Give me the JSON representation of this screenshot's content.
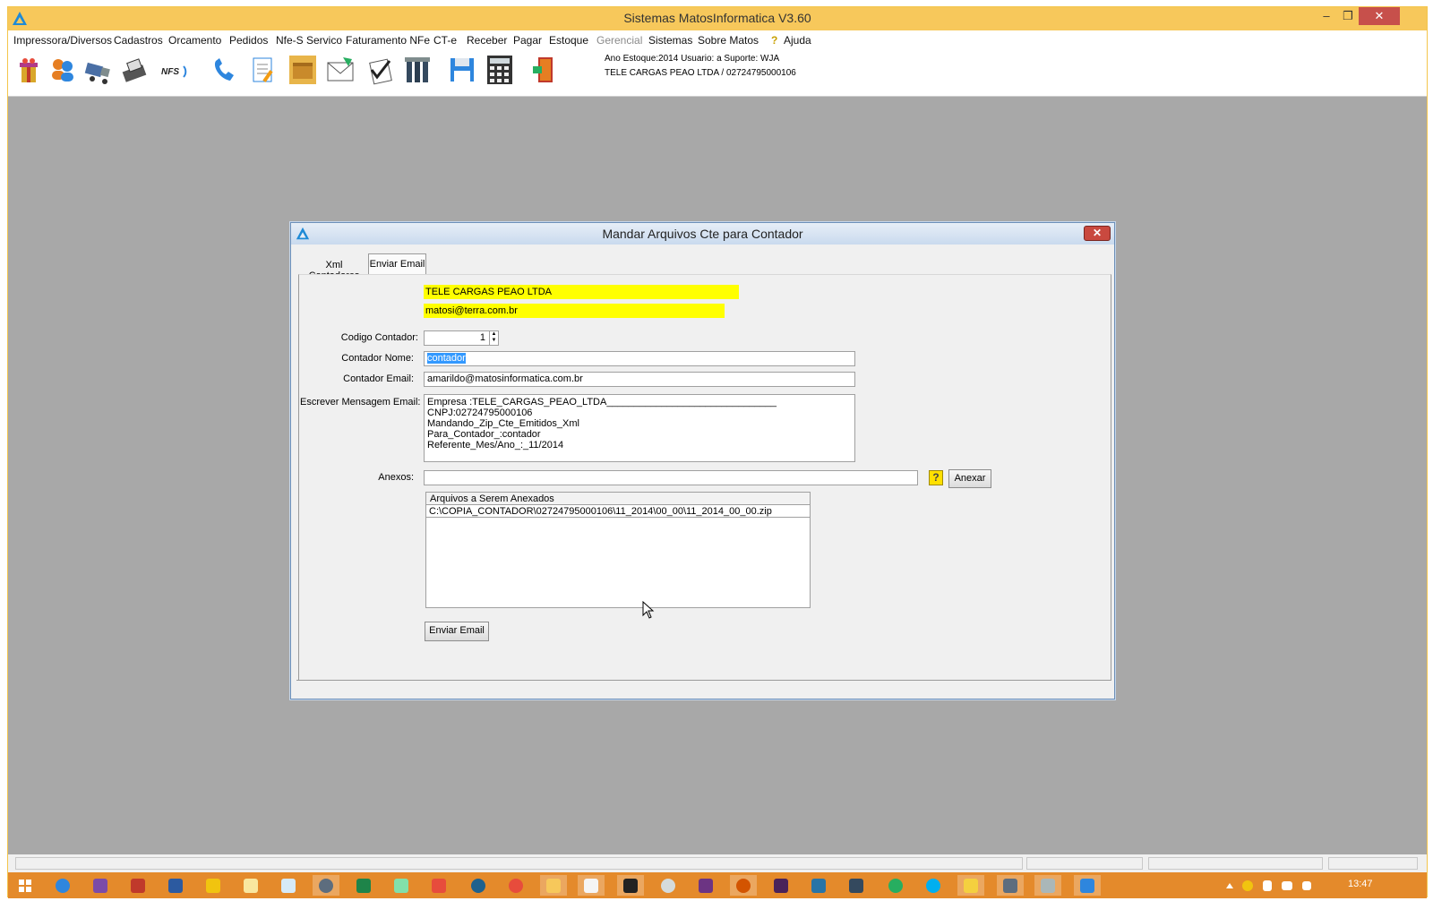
{
  "window": {
    "title": "Sistemas MatosInformatica V3.60",
    "controls": {
      "minimize": "–",
      "restore": "❐",
      "close": "✕"
    }
  },
  "menu": [
    {
      "label": "Impressora/Diversos",
      "disabled": false
    },
    {
      "label": "Cadastros",
      "disabled": false
    },
    {
      "label": "Orcamento",
      "disabled": false
    },
    {
      "label": "Pedidos",
      "disabled": false
    },
    {
      "label": "Nfe-S Servico",
      "disabled": false
    },
    {
      "label": "Faturamento NFe",
      "disabled": false
    },
    {
      "label": "CT-e",
      "disabled": false
    },
    {
      "label": "Receber",
      "disabled": false
    },
    {
      "label": "Pagar",
      "disabled": false
    },
    {
      "label": "Estoque",
      "disabled": false
    },
    {
      "label": "Gerencial",
      "disabled": true
    },
    {
      "label": "Sistemas",
      "disabled": false
    },
    {
      "label": "Sobre Matos",
      "disabled": false
    },
    {
      "label": "Ajuda",
      "disabled": false
    }
  ],
  "help_glyph": "?",
  "toolbar": {
    "icons": [
      "gift-icon",
      "users-icon",
      "truck-icon",
      "printer-icon",
      "nfse-icon",
      "phone-icon",
      "document-edit-icon",
      "box-icon",
      "mail-icon",
      "checklist-icon",
      "tools-icon",
      "save-icon",
      "calculator-icon",
      "exit-icon"
    ],
    "nfs_text": "NFS",
    "info_line1": "Ano Estoque:2014 Usuario: a Suporte: WJA",
    "info_line2": "TELE CARGAS PEAO LTDA / 02724795000106"
  },
  "dialog": {
    "title": "Mandar Arquivos Cte para Contador",
    "close": "✕",
    "tabs": [
      {
        "label": "Xml Contadores",
        "active": false
      },
      {
        "label": "Enviar Email",
        "active": true
      }
    ],
    "company_name": "TELE CARGAS PEAO LTDA",
    "company_email": "matosi@terra.com.br",
    "codigo_label": "Codigo Contador:",
    "codigo_value": "1",
    "spin_up": "▲",
    "spin_down": "▼",
    "nome_label": "Contador Nome:",
    "nome_value": "contador",
    "email_label": "Contador Email:",
    "email_value": "amarildo@matosinformatica.com.br",
    "mensagem_label": "Escrever Mensagem Email:",
    "mensagem_lines": [
      "Empresa :TELE_CARGAS_PEAO_LTDA_______________________________",
      "CNPJ:02724795000106",
      "Mandando_Zip_Cte_Emitidos_Xml",
      "Para_Contador_:contador",
      "Referente_Mes/Ano_:_11/2014"
    ],
    "anexos_label": "Anexos:",
    "anexos_value": "",
    "help_button": "?",
    "anexar_button": "Anexar",
    "attachments_header": "Arquivos a Serem Anexados",
    "attachments": [
      "C:\\COPIA_CONTADOR\\02724795000106\\11_2014\\00_00\\11_2014_00_00.zip"
    ],
    "send_button": "Enviar Email"
  },
  "taskbar": {
    "clock": "13:47",
    "start_icon": "windows-start-icon"
  },
  "colors": {
    "titlebar": "#f7c85b",
    "taskbar": "#e48a2b",
    "highlight": "#ffff00",
    "selection": "#3399ff",
    "workspace": "#a8a8a8"
  }
}
